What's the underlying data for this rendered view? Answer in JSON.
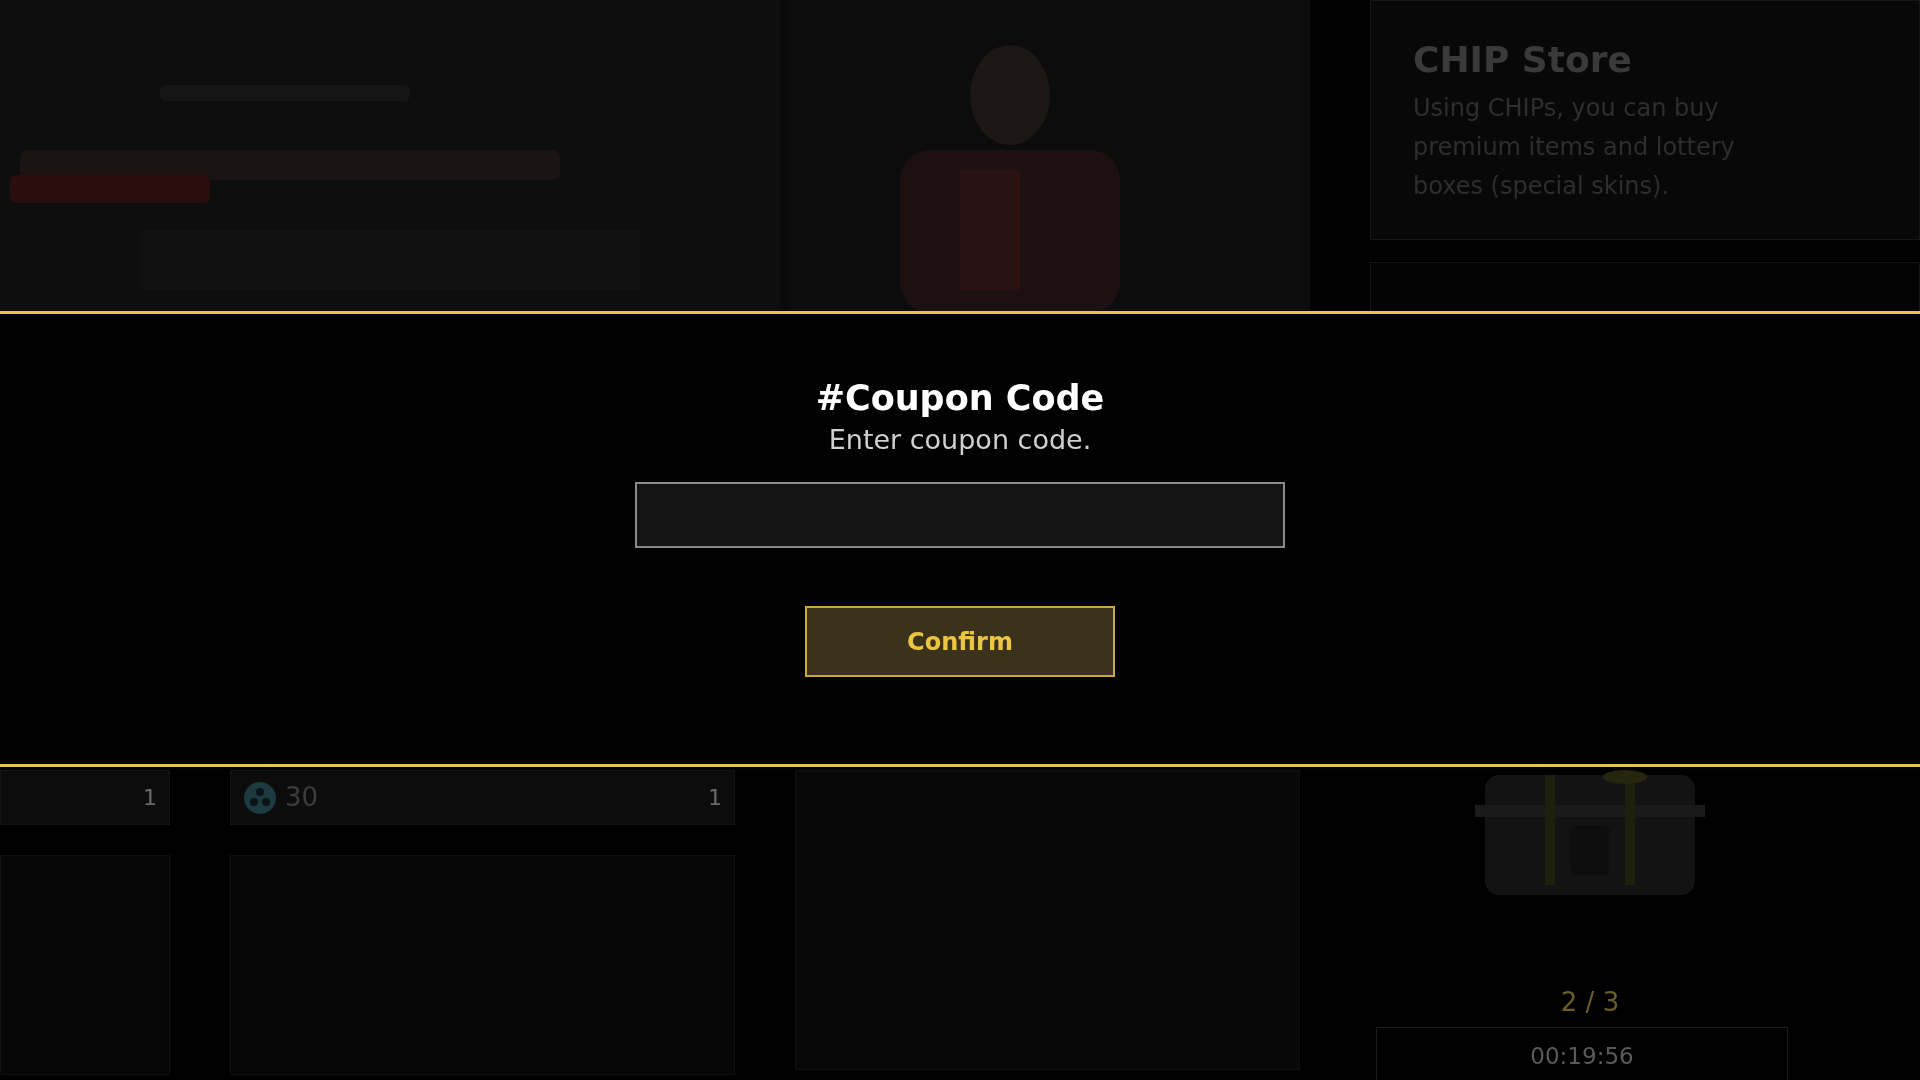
{
  "background": {
    "item_cards": [
      {
        "count": "1"
      },
      {
        "price": "30",
        "count": "1"
      }
    ],
    "store_cards": [
      {
        "title": "CHIP Store",
        "description": "Using CHIPs, you can buy premium items and lottery boxes (special skins)."
      }
    ],
    "supply_box": {
      "progress": "2 / 3",
      "timer": "00:19:56"
    }
  },
  "dialog": {
    "title": "#Coupon Code",
    "subtitle": "Enter coupon code.",
    "button": "Confirm"
  }
}
